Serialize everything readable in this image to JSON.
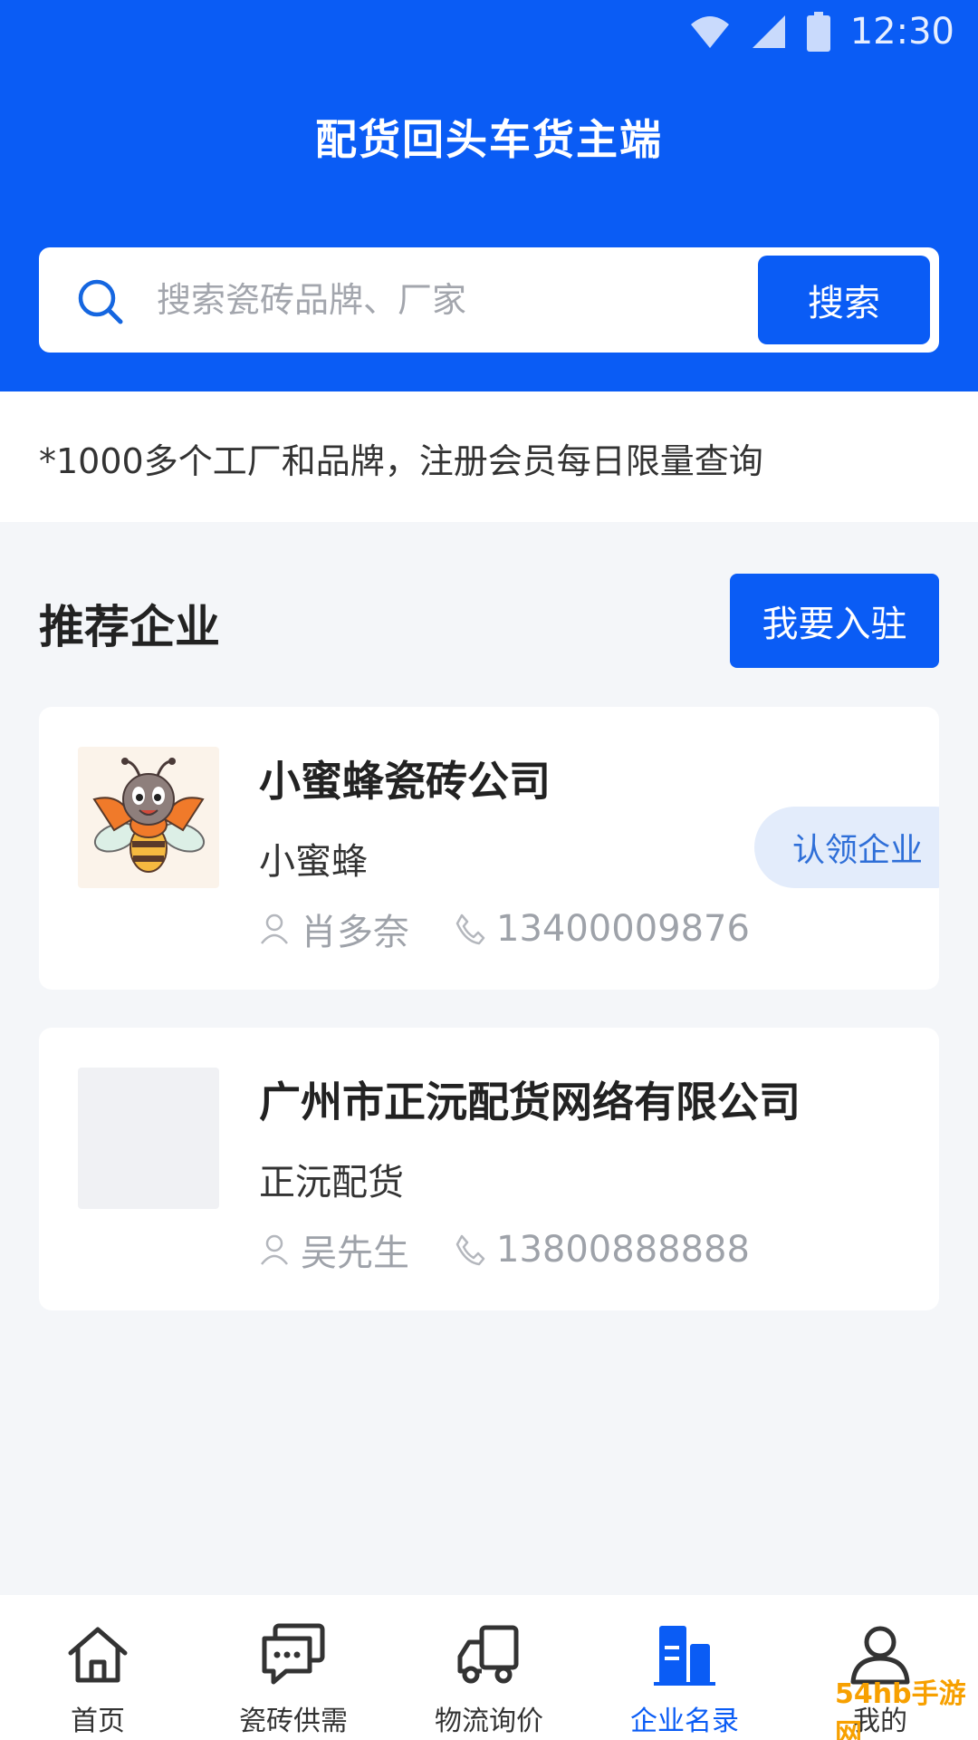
{
  "status_bar": {
    "time": "12:30"
  },
  "header": {
    "title": "配货回头车货主端"
  },
  "search": {
    "placeholder": "搜索瓷砖品牌、厂家",
    "button_label": "搜索"
  },
  "notice": {
    "text": "*1000多个工厂和品牌，注册会员每日限量查询"
  },
  "section": {
    "title": "推荐企业",
    "join_button": "我要入驻"
  },
  "companies": [
    {
      "name": "小蜜蜂瓷砖公司",
      "short_name": "小蜜蜂",
      "contact": "肖多奈",
      "phone": "13400009876",
      "claim_label": "认领企业",
      "logo_icon": "bee-mascot-logo"
    },
    {
      "name": "广州市正沅配货网络有限公司",
      "short_name": "正沅配货",
      "contact": "吴先生",
      "phone": "13800888888",
      "logo_icon": "placeholder-logo"
    }
  ],
  "tabbar": {
    "active": "企业名录",
    "items": [
      {
        "label": "首页",
        "icon": "home-icon"
      },
      {
        "label": "瓷砖供需",
        "icon": "chat-icon"
      },
      {
        "label": "物流询价",
        "icon": "truck-icon"
      },
      {
        "label": "企业名录",
        "icon": "building-icon"
      },
      {
        "label": "我的",
        "icon": "user-icon"
      }
    ]
  },
  "watermark": {
    "text": "54hb手游网"
  },
  "colors": {
    "primary": "#0a5cf5",
    "background": "#f4f6f9",
    "muted": "#9ea2a9",
    "claim_bg": "#e3ecfb"
  }
}
